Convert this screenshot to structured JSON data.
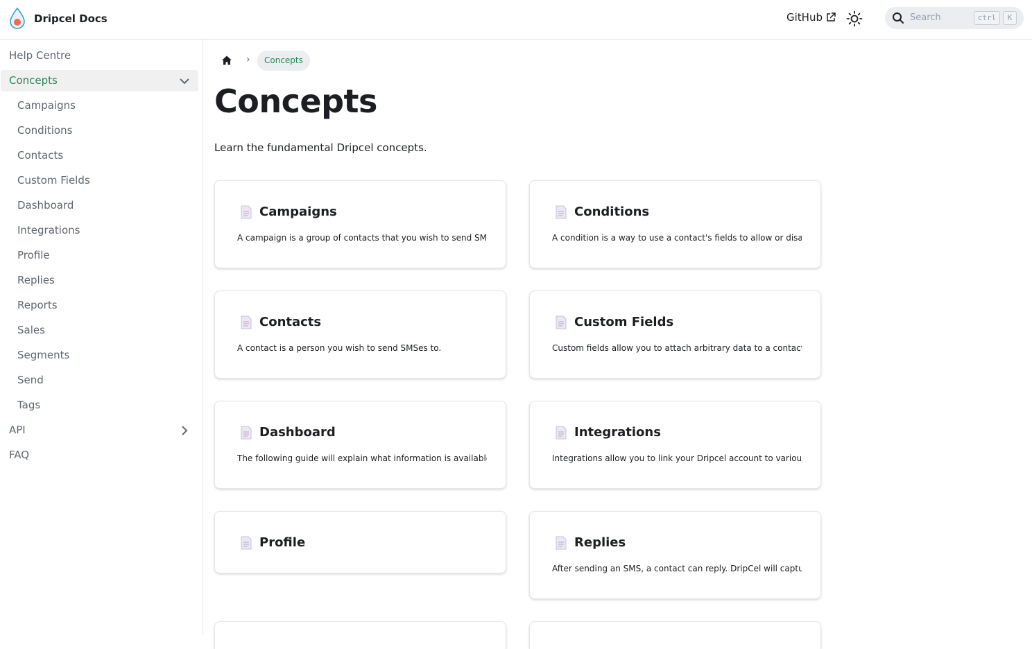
{
  "header": {
    "brand": "Dripcel Docs",
    "github": "GitHub",
    "search_placeholder": "Search",
    "kbd_ctrl": "ctrl",
    "kbd_k": "K"
  },
  "sidebar": {
    "items": [
      {
        "label": "Help Centre"
      },
      {
        "label": "Concepts"
      },
      {
        "label": "Campaigns"
      },
      {
        "label": "Conditions"
      },
      {
        "label": "Contacts"
      },
      {
        "label": "Custom Fields"
      },
      {
        "label": "Dashboard"
      },
      {
        "label": "Integrations"
      },
      {
        "label": "Profile"
      },
      {
        "label": "Replies"
      },
      {
        "label": "Reports"
      },
      {
        "label": "Sales"
      },
      {
        "label": "Segments"
      },
      {
        "label": "Send"
      },
      {
        "label": "Tags"
      },
      {
        "label": "API"
      },
      {
        "label": "FAQ"
      }
    ]
  },
  "breadcrumb": {
    "current": "Concepts"
  },
  "main": {
    "title": "Concepts",
    "description": "Learn the fundamental Dripcel concepts.",
    "cards": [
      {
        "title": "Campaigns",
        "desc": "A campaign is a group of contacts that you wish to send SMS..."
      },
      {
        "title": "Conditions",
        "desc": "A condition is a way to use a contact's fields to allow or disall..."
      },
      {
        "title": "Contacts",
        "desc": "A contact is a person you wish to send SMSes to."
      },
      {
        "title": "Custom Fields",
        "desc": "Custom fields allow you to attach arbitrary data to a contact."
      },
      {
        "title": "Dashboard",
        "desc": "The following guide will explain what information is available..."
      },
      {
        "title": "Integrations",
        "desc": "Integrations allow you to link your Dripcel account to various..."
      },
      {
        "title": "Profile",
        "desc": ""
      },
      {
        "title": "Replies",
        "desc": "After sending an SMS, a contact can reply. DripCel will captur..."
      }
    ]
  },
  "colors": {
    "accent": "#2e8555",
    "active_bg": "#f0f0f0",
    "search_bg": "#ebedf0"
  }
}
